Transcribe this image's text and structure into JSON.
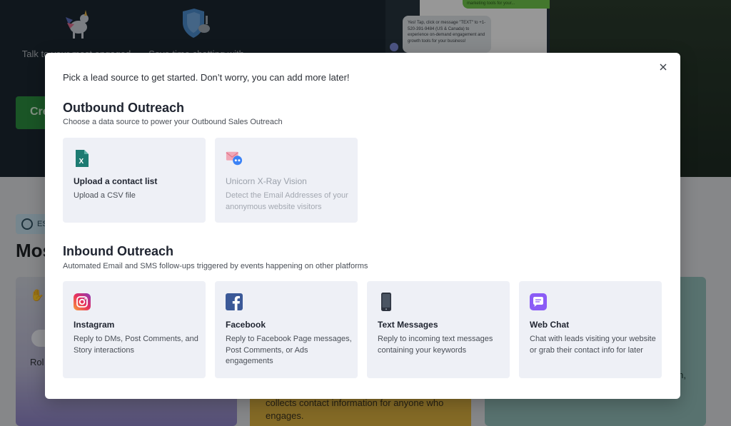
{
  "background": {
    "feature1_text": "Talk to your most engaged lea",
    "feature2_text": "Save time chatting with",
    "cta_text": "Cre",
    "phone_green_text": "marketing tools for your...",
    "phone_grey_text": "Yes! Tap, click or message \"TEXT\" to +1-520-391-9484 (US & Canada) to experience on-demand engagement and growth tools for your business!",
    "chip_text": "ES",
    "heading_text": "Mos",
    "card1_text": "Rol",
    "card2_text": "collects contact information for anyone who engages.",
    "card3_text": "n,"
  },
  "modal": {
    "intro": "Pick a lead source to get started. Don’t worry, you can add more later!",
    "outbound": {
      "title": "Outbound Outreach",
      "subtitle": "Choose a data source to power your Outbound Sales Outreach",
      "cards": [
        {
          "title": "Upload a contact list",
          "desc": "Upload a CSV file",
          "icon": "csv-file-icon"
        },
        {
          "title": "Unicorn X-Ray Vision",
          "desc": "Detect the Email Addresses of your anonymous website visitors",
          "icon": "email-xray-icon"
        }
      ]
    },
    "inbound": {
      "title": "Inbound Outreach",
      "subtitle": "Automated Email and SMS follow-ups triggered by events happening on other platforms",
      "cards": [
        {
          "title": "Instagram",
          "desc": "Reply to DMs, Post Comments, and Story interactions",
          "icon": "instagram-icon"
        },
        {
          "title": "Facebook",
          "desc": "Reply to Facebook Page messages, Post Comments, or Ads engagements",
          "icon": "facebook-icon"
        },
        {
          "title": "Text Messages",
          "desc": "Reply to incoming text messages containing your keywords",
          "icon": "phone-icon"
        },
        {
          "title": "Web Chat",
          "desc": "Chat with leads visiting your website or grab their contact info for later",
          "icon": "chat-icon"
        }
      ]
    }
  },
  "colors": {
    "modal_bg": "#ffffff",
    "card_bg": "#eef0f6",
    "csv_green": "#1d7b72",
    "facebook_blue": "#3b5998",
    "chat_purple": "#8b5cf6"
  }
}
